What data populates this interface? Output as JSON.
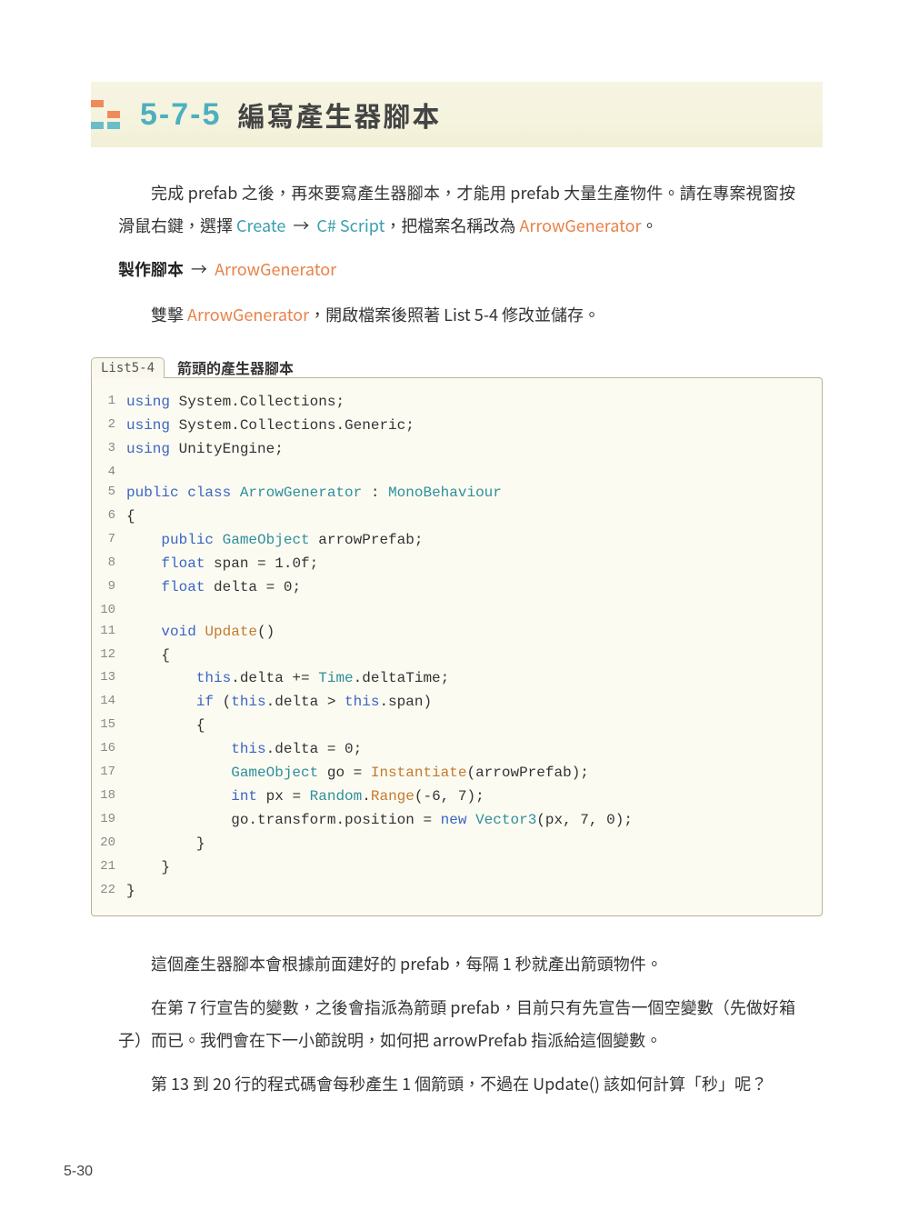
{
  "section": {
    "number": "5-7-5",
    "title": "編寫產生器腳本"
  },
  "para1": {
    "pre": "完成 prefab 之後，再來要寫產生器腳本，才能用 prefab 大量生產物件。請在專案視窗按滑鼠右鍵，選擇 ",
    "create": "Create",
    "arrow1": " → ",
    "script": "C# Script",
    "mid": "，把檔案名稱改為 ",
    "gen": "ArrowGenerator",
    "post": "。"
  },
  "makeLine": {
    "bold": "製作腳本",
    "arrow": " → ",
    "gen": "ArrowGenerator"
  },
  "para2": {
    "pre": "雙擊 ",
    "gen": "ArrowGenerator",
    "post": "，開啟檔案後照著 List 5-4 修改並儲存。"
  },
  "listing": {
    "badge": "List5-4",
    "caption": "箭頭的產生器腳本"
  },
  "code": {
    "lines": [
      {
        "n": "1",
        "segs": [
          [
            "kw",
            "using"
          ],
          [
            "plain",
            " System.Collections;"
          ]
        ]
      },
      {
        "n": "2",
        "segs": [
          [
            "kw",
            "using"
          ],
          [
            "plain",
            " System.Collections.Generic;"
          ]
        ]
      },
      {
        "n": "3",
        "segs": [
          [
            "kw",
            "using"
          ],
          [
            "plain",
            " UnityEngine;"
          ]
        ]
      },
      {
        "n": "4",
        "segs": [
          [
            "plain",
            ""
          ]
        ]
      },
      {
        "n": "5",
        "segs": [
          [
            "kw",
            "public class"
          ],
          [
            "plain",
            " "
          ],
          [
            "type",
            "ArrowGenerator"
          ],
          [
            "plain",
            " : "
          ],
          [
            "type",
            "MonoBehaviour"
          ]
        ]
      },
      {
        "n": "6",
        "segs": [
          [
            "plain",
            "{"
          ]
        ]
      },
      {
        "n": "7",
        "segs": [
          [
            "plain",
            "    "
          ],
          [
            "kw",
            "public"
          ],
          [
            "plain",
            " "
          ],
          [
            "type",
            "GameObject"
          ],
          [
            "plain",
            " arrowPrefab;"
          ]
        ]
      },
      {
        "n": "8",
        "segs": [
          [
            "plain",
            "    "
          ],
          [
            "kw",
            "float"
          ],
          [
            "plain",
            " span = 1.0f;"
          ]
        ]
      },
      {
        "n": "9",
        "segs": [
          [
            "plain",
            "    "
          ],
          [
            "kw",
            "float"
          ],
          [
            "plain",
            " delta = 0;"
          ]
        ]
      },
      {
        "n": "10",
        "segs": [
          [
            "plain",
            ""
          ]
        ]
      },
      {
        "n": "11",
        "segs": [
          [
            "plain",
            "    "
          ],
          [
            "kw",
            "void"
          ],
          [
            "plain",
            " "
          ],
          [
            "meth",
            "Update"
          ],
          [
            "plain",
            "()"
          ]
        ]
      },
      {
        "n": "12",
        "segs": [
          [
            "plain",
            "    {"
          ]
        ]
      },
      {
        "n": "13",
        "segs": [
          [
            "plain",
            "        "
          ],
          [
            "kw",
            "this"
          ],
          [
            "plain",
            ".delta += "
          ],
          [
            "type",
            "Time"
          ],
          [
            "plain",
            ".deltaTime;"
          ]
        ]
      },
      {
        "n": "14",
        "segs": [
          [
            "plain",
            "        "
          ],
          [
            "kw",
            "if"
          ],
          [
            "plain",
            " ("
          ],
          [
            "kw",
            "this"
          ],
          [
            "plain",
            ".delta > "
          ],
          [
            "kw",
            "this"
          ],
          [
            "plain",
            ".span)"
          ]
        ]
      },
      {
        "n": "15",
        "segs": [
          [
            "plain",
            "        {"
          ]
        ]
      },
      {
        "n": "16",
        "segs": [
          [
            "plain",
            "            "
          ],
          [
            "kw",
            "this"
          ],
          [
            "plain",
            ".delta = 0;"
          ]
        ]
      },
      {
        "n": "17",
        "segs": [
          [
            "plain",
            "            "
          ],
          [
            "type",
            "GameObject"
          ],
          [
            "plain",
            " go = "
          ],
          [
            "meth",
            "Instantiate"
          ],
          [
            "plain",
            "(arrowPrefab);"
          ]
        ]
      },
      {
        "n": "18",
        "segs": [
          [
            "plain",
            "            "
          ],
          [
            "kw",
            "int"
          ],
          [
            "plain",
            " px = "
          ],
          [
            "type",
            "Random"
          ],
          [
            "plain",
            "."
          ],
          [
            "meth",
            "Range"
          ],
          [
            "plain",
            "(-6, 7);"
          ]
        ]
      },
      {
        "n": "19",
        "segs": [
          [
            "plain",
            "            go.transform.position = "
          ],
          [
            "kw",
            "new"
          ],
          [
            "plain",
            " "
          ],
          [
            "type",
            "Vector3"
          ],
          [
            "plain",
            "(px, 7, 0);"
          ]
        ]
      },
      {
        "n": "20",
        "segs": [
          [
            "plain",
            "        }"
          ]
        ]
      },
      {
        "n": "21",
        "segs": [
          [
            "plain",
            "    }"
          ]
        ]
      },
      {
        "n": "22",
        "segs": [
          [
            "plain",
            "}"
          ]
        ]
      }
    ]
  },
  "para3": "這個產生器腳本會根據前面建好的 prefab，每隔 1 秒就產出箭頭物件。",
  "para4": "在第 7 行宣告的變數，之後會指派為箭頭 prefab，目前只有先宣告一個空變數（先做好箱子）而已。我們會在下一小節說明，如何把 arrowPrefab 指派給這個變數。",
  "para5": "第 13 到 20 行的程式碼會每秒產生 1 個箭頭，不過在 Update() 該如何計算「秒」呢？",
  "pageNumber": "5-30"
}
